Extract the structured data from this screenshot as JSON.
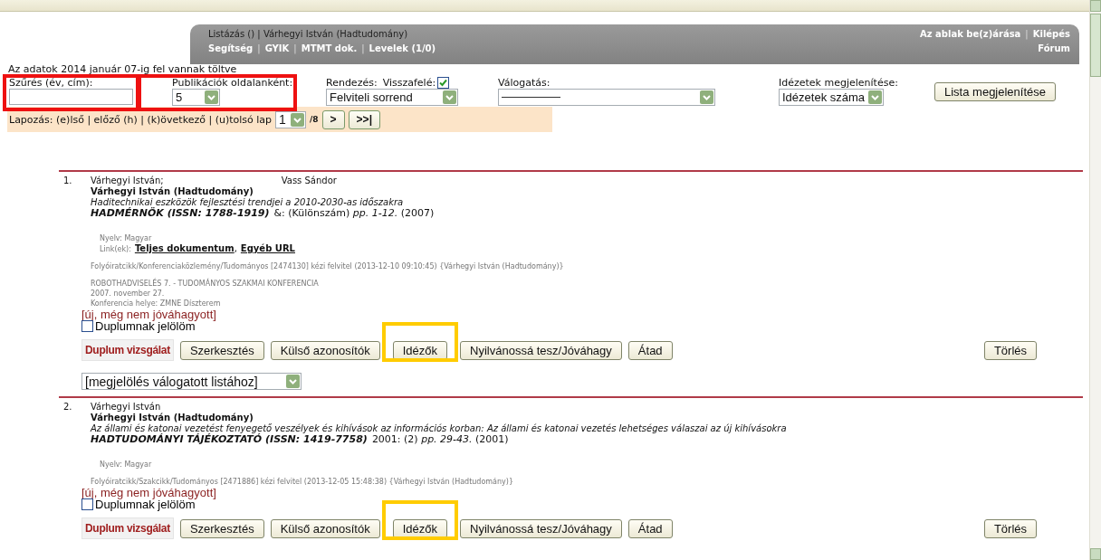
{
  "header": {
    "title": "Listázás () | Várhegyi István (Hadtudomány)",
    "links": [
      "Segítség",
      "GYIK",
      "MTMT dok.",
      "Levelek (1/0)"
    ],
    "separator": "|",
    "right_links": [
      "Az ablak be(z)árása",
      "Kilépés"
    ],
    "forum": "Fórum"
  },
  "notice": "Az adatok 2014 január 07-ig fel vannak töltve",
  "controls": [
    {
      "kind": "text",
      "label": "Szűrés (év, cím):",
      "highlighted": true
    },
    {
      "kind": "select",
      "label": "Publikációk oldalanként:",
      "value": "5",
      "highlighted": true
    },
    {
      "kind": "select",
      "label": "Rendezés:",
      "check_label": "Visszafelé:",
      "checked": true,
      "value": "Felviteli sorrend"
    },
    {
      "kind": "select",
      "label": "Válogatás:"
    },
    {
      "kind": "select",
      "label": "Idézetek megjelenítése:",
      "value": "Idézetek száma"
    },
    {
      "kind": "button",
      "label": "Lista megjelenítése"
    }
  ],
  "paging": {
    "label": "Lapozás: (e)lső | előző (h) | (k)övetkező | (u)tolsó lap",
    "page": "1",
    "total": "/8",
    "buttons": [
      ">",
      ">>|"
    ]
  },
  "records": [
    {
      "number": "1.",
      "authors": [
        "Várhegyi István;",
        "Vass Sándor"
      ],
      "owner": "Várhegyi István (Hadtudomány)",
      "title": "Haditechnikai eszközök fejlesztési trendjei a 2010-2030-as időszakra",
      "journal": "HADMÉRNÖK (ISSN: 1788-1919)",
      "source": "&: (Különszám) *pp. 1-12.* (2007)",
      "language": "Nyelv: Magyar",
      "links_label": "Link(ek):",
      "links": [
        "Teljes dokumentum",
        "Egyéb URL"
      ],
      "links_separator": ",",
      "meta": "Folyóiratcikk/Konferenciaközlemény/Tudományos [2474130] kézi felvitel (2013-12-10 09:10:45) {Várhegyi István (Hadtudomány)}",
      "conference": [
        "ROBOTHADVISELÉS 7. - TUDOMÁNYOS SZAKMAI KONFERENCIA",
        "2007. november 27.",
        "Konferencia helye: ZMNE Díszterem"
      ],
      "status": "[új, még nem jóváhagyott]",
      "duplicate_label": "Duplumnak jelölöm",
      "duplicate_checked": false,
      "duplum": "Duplum vizsgálat",
      "actions": [
        {
          "label": "Szerkesztés",
          "highlighted": false
        },
        {
          "label": "Külső azonosítók",
          "highlighted": false
        },
        {
          "label": "Idézők",
          "highlighted": true
        },
        {
          "label": "Nyilvánossá tesz/Jóváhagy",
          "highlighted": false
        },
        {
          "label": "Átad",
          "highlighted": false
        }
      ],
      "delete": "Törlés",
      "mark_select": "[megjelölés válogatott listához]"
    },
    {
      "number": "2.",
      "authors": [
        "Várhegyi István"
      ],
      "owner": "Várhegyi István (Hadtudomány)",
      "title": "Az állami és katonai vezetést fenyegető veszélyek és kihívások az információs korban: Az állami és katonai vezetés lehetséges válaszai az új kihívásokra",
      "journal": "HADTUDOMÁNYI TÁJÉKOZTATÓ (ISSN: 1419-7758)",
      "source": "2001: (2) *pp. 29-43.* (2001)",
      "language": "Nyelv: Magyar",
      "meta": "Folyóiratcikk/Szakcikk/Tudományos [2471886] kézi felvitel (2013-12-05 15:48:38) {Várhegyi István (Hadtudomány)}",
      "status": "[új, még nem jóváhagyott]",
      "duplicate_label": "Duplumnak jelölöm",
      "duplicate_checked": false,
      "duplum": "Duplum vizsgálat",
      "actions": [
        {
          "label": "Szerkesztés",
          "highlighted": false
        },
        {
          "label": "Külső azonosítók",
          "highlighted": false
        },
        {
          "label": "Idézők",
          "highlighted": true
        },
        {
          "label": "Nyilvánossá tesz/Jóváhagy",
          "highlighted": false
        },
        {
          "label": "Átad",
          "highlighted": false
        }
      ],
      "delete": "Törlés"
    }
  ]
}
